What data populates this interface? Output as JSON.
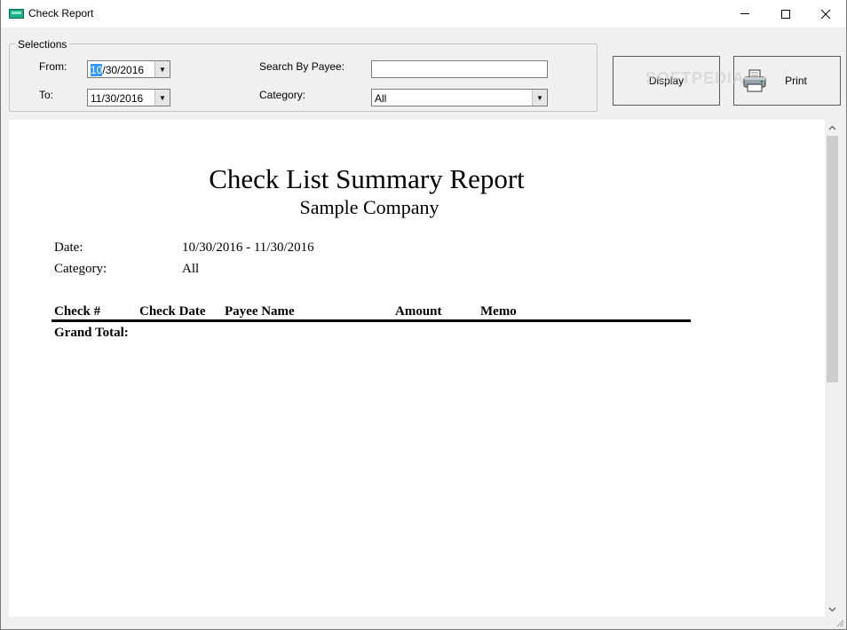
{
  "window": {
    "title": "Check Report",
    "icon": "check-report-app-icon"
  },
  "selections": {
    "legend": "Selections",
    "from_label": "From:",
    "from_value_selected": "10",
    "from_value_rest": "/30/2016",
    "to_label": "To:",
    "to_value": "11/30/2016",
    "payee_label": "Search By Payee:",
    "payee_value": "",
    "category_label": "Category:",
    "category_value": "All"
  },
  "buttons": {
    "display_label": "Display",
    "print_label": "Print"
  },
  "watermark": "SOFTPEDIA",
  "report": {
    "title": "Check List Summary Report",
    "company": "Sample Company",
    "date_label": "Date:",
    "date_value": "10/30/2016 - 11/30/2016",
    "category_label": "Category:",
    "category_value": "All",
    "columns": [
      "Check #",
      "Check Date",
      "Payee Name",
      "Amount",
      "Memo"
    ],
    "grand_total_label": "Grand Total:"
  },
  "colors": {
    "accent_selection": "#3399ff",
    "app_icon": "#1fae8a"
  }
}
